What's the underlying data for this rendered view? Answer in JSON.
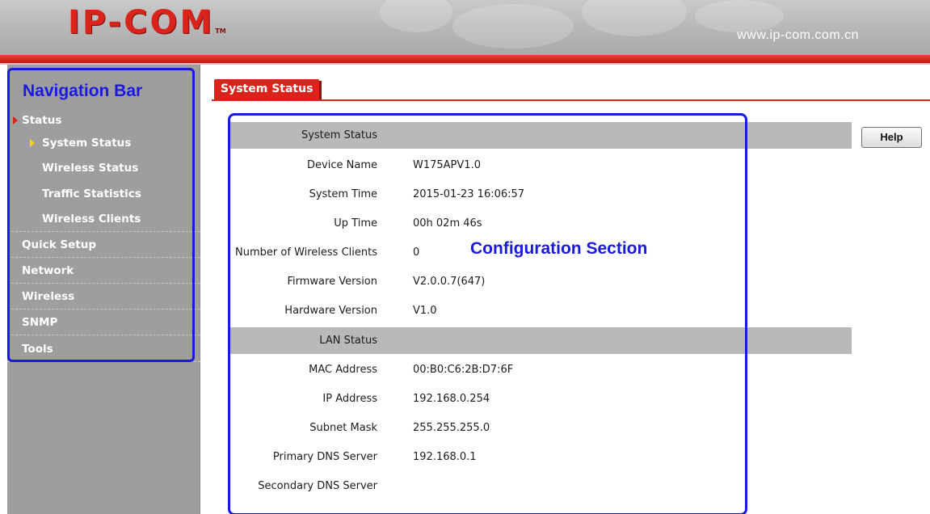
{
  "header": {
    "logo_text": "IP-COM",
    "logo_tm": "TM",
    "url": "www.ip-com.com.cn",
    "colors": {
      "accent": "#d9231b",
      "header_gray": "#b6b6b6"
    }
  },
  "annotations": {
    "nav_label": "Navigation Bar",
    "config_label": "Configuration Section",
    "color": "#1a1adf"
  },
  "sidebar": {
    "items": [
      {
        "label": "Status",
        "level": "top",
        "expanded": true,
        "icon": "red-arrow-icon"
      },
      {
        "label": "System Status",
        "level": "sub",
        "selected": true,
        "icon": "yellow-arrow-icon"
      },
      {
        "label": "Wireless Status",
        "level": "sub"
      },
      {
        "label": "Traffic Statistics",
        "level": "sub"
      },
      {
        "label": "Wireless Clients",
        "level": "sub"
      },
      {
        "label": "Quick Setup",
        "level": "top"
      },
      {
        "label": "Network",
        "level": "top"
      },
      {
        "label": "Wireless",
        "level": "top"
      },
      {
        "label": "SNMP",
        "level": "top"
      },
      {
        "label": "Tools",
        "level": "top"
      }
    ]
  },
  "main": {
    "tab_label": "System Status",
    "help_label": "Help",
    "system_section_title": "System Status",
    "system_rows": [
      {
        "label": "Device Name",
        "value": "W175APV1.0"
      },
      {
        "label": "System Time",
        "value": "2015-01-23 16:06:57"
      },
      {
        "label": "Up Time",
        "value": "00h 02m 46s"
      },
      {
        "label": "Number of Wireless Clients",
        "value": "0"
      },
      {
        "label": "Firmware Version",
        "value": "V2.0.0.7(647)"
      },
      {
        "label": "Hardware Version",
        "value": "V1.0"
      }
    ],
    "lan_section_title": "LAN Status",
    "lan_rows": [
      {
        "label": "MAC Address",
        "value": "00:B0:C6:2B:D7:6F"
      },
      {
        "label": "IP Address",
        "value": "192.168.0.254"
      },
      {
        "label": "Subnet Mask",
        "value": "255.255.255.0"
      },
      {
        "label": "Primary DNS Server",
        "value": "192.168.0.1"
      },
      {
        "label": "Secondary DNS Server",
        "value": ""
      }
    ]
  }
}
